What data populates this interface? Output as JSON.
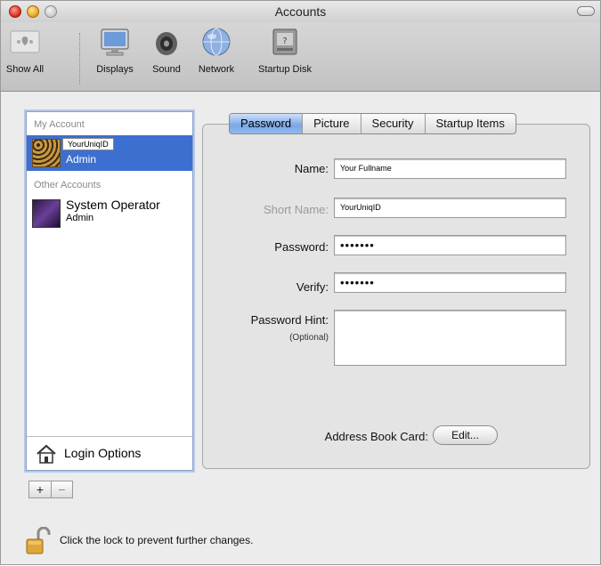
{
  "window": {
    "title": "Accounts"
  },
  "toolbar": {
    "items": [
      {
        "label": "Show All",
        "icon": "apple-grid-icon"
      },
      {
        "label": "Displays",
        "icon": "display-icon"
      },
      {
        "label": "Sound",
        "icon": "speaker-icon"
      },
      {
        "label": "Network",
        "icon": "globe-icon"
      },
      {
        "label": "Startup Disk",
        "icon": "disk-icon"
      }
    ]
  },
  "sidebar": {
    "my_account_label": "My Account",
    "my_account": {
      "name": "YourUniqID",
      "role": "Admin"
    },
    "other_accounts_label": "Other Accounts",
    "other_account": {
      "name": "System Operator",
      "role": "Admin"
    },
    "login_options_label": "Login Options"
  },
  "controls": {
    "add": "+",
    "remove": "−"
  },
  "tabs": [
    {
      "label": "Password",
      "active": true
    },
    {
      "label": "Picture"
    },
    {
      "label": "Security"
    },
    {
      "label": "Startup Items"
    }
  ],
  "form": {
    "name_label": "Name:",
    "name_value": "Your Fullname",
    "short_name_label": "Short Name:",
    "short_name_value": "YourUniqID",
    "password_label": "Password:",
    "password_value": "•••••••",
    "verify_label": "Verify:",
    "verify_value": "•••••••",
    "hint_label": "Password Hint:",
    "hint_optional": "(Optional)",
    "hint_value": "",
    "address_book_label": "Address Book Card:",
    "edit_button": "Edit..."
  },
  "footer": {
    "lock_text": "Click the lock to prevent further changes."
  },
  "colors": {
    "selection": "#3d6fd0",
    "tab_active": "#79a7e6"
  }
}
